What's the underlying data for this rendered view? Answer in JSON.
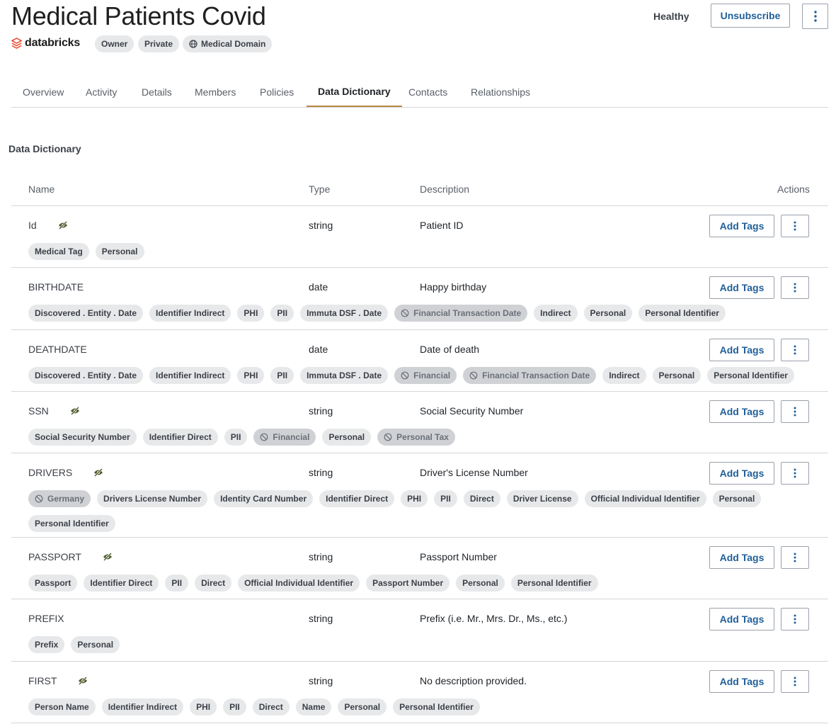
{
  "header": {
    "title": "Medical Patients Covid",
    "health_status": "Healthy",
    "unsubscribe_label": "Unsubscribe",
    "logo_text": "databricks",
    "chips": [
      {
        "label": "Owner",
        "icon": null
      },
      {
        "label": "Private",
        "icon": null
      },
      {
        "label": "Medical Domain",
        "icon": "globe-icon"
      }
    ]
  },
  "tabs": [
    {
      "label": "Overview",
      "active": false
    },
    {
      "label": "Activity",
      "active": false
    },
    {
      "label": "Details",
      "active": false
    },
    {
      "label": "Members",
      "active": false
    },
    {
      "label": "Policies",
      "active": false
    },
    {
      "label": "Data Dictionary",
      "active": true
    },
    {
      "label": "Contacts",
      "active": false
    },
    {
      "label": "Relationships",
      "active": false
    }
  ],
  "section": {
    "title": "Data Dictionary"
  },
  "table": {
    "columns": [
      "Name",
      "Type",
      "Description",
      "Actions"
    ],
    "add_tags_label": "Add Tags",
    "rows": [
      {
        "name": "Id",
        "masked": true,
        "type": "string",
        "description": "Patient ID",
        "tags": [
          {
            "label": "Medical Tag"
          },
          {
            "label": "Personal"
          }
        ]
      },
      {
        "name": "BIRTHDATE",
        "masked": false,
        "type": "date",
        "description": "Happy birthday",
        "tags": [
          {
            "label": "Discovered . Entity . Date"
          },
          {
            "label": "Identifier Indirect"
          },
          {
            "label": "PHI"
          },
          {
            "label": "PII"
          },
          {
            "label": "Immuta DSF . Date"
          },
          {
            "label": "Financial Transaction Date",
            "disabled": true
          },
          {
            "label": "Indirect"
          },
          {
            "label": "Personal"
          },
          {
            "label": "Personal Identifier"
          }
        ]
      },
      {
        "name": "DEATHDATE",
        "masked": false,
        "type": "date",
        "description": "Date of death",
        "tags": [
          {
            "label": "Discovered . Entity . Date"
          },
          {
            "label": "Identifier Indirect"
          },
          {
            "label": "PHI"
          },
          {
            "label": "PII"
          },
          {
            "label": "Immuta DSF . Date"
          },
          {
            "label": "Financial",
            "disabled": true
          },
          {
            "label": "Financial Transaction Date",
            "disabled": true
          },
          {
            "label": "Indirect"
          },
          {
            "label": "Personal"
          },
          {
            "label": "Personal Identifier"
          }
        ]
      },
      {
        "name": "SSN",
        "masked": true,
        "type": "string",
        "description": "Social Security Number",
        "tags": [
          {
            "label": "Social Security Number"
          },
          {
            "label": "Identifier Direct"
          },
          {
            "label": "PII"
          },
          {
            "label": "Financial",
            "disabled": true
          },
          {
            "label": "Personal"
          },
          {
            "label": "Personal Tax",
            "disabled": true
          }
        ]
      },
      {
        "name": "DRIVERS",
        "masked": true,
        "type": "string",
        "description": "Driver's License Number",
        "tags": [
          {
            "label": "Germany",
            "disabled": true
          },
          {
            "label": "Drivers License Number"
          },
          {
            "label": "Identity Card Number"
          },
          {
            "label": "Identifier Direct"
          },
          {
            "label": "PHI"
          },
          {
            "label": "PII"
          },
          {
            "label": "Direct"
          },
          {
            "label": "Driver License"
          },
          {
            "label": "Official Individual Identifier"
          },
          {
            "label": "Personal"
          },
          {
            "label": "Personal Identifier"
          }
        ]
      },
      {
        "name": "PASSPORT",
        "masked": true,
        "type": "string",
        "description": "Passport Number",
        "tags": [
          {
            "label": "Passport"
          },
          {
            "label": "Identifier Direct"
          },
          {
            "label": "PII"
          },
          {
            "label": "Direct"
          },
          {
            "label": "Official Individual Identifier"
          },
          {
            "label": "Passport Number"
          },
          {
            "label": "Personal"
          },
          {
            "label": "Personal Identifier"
          }
        ]
      },
      {
        "name": "PREFIX",
        "masked": false,
        "type": "string",
        "description": "Prefix (i.e. Mr., Mrs. Dr., Ms., etc.)",
        "tags": [
          {
            "label": "Prefix"
          },
          {
            "label": "Personal"
          }
        ]
      },
      {
        "name": "FIRST",
        "masked": true,
        "type": "string",
        "description": "No description provided.",
        "tags": [
          {
            "label": "Person Name"
          },
          {
            "label": "Identifier Indirect"
          },
          {
            "label": "PHI"
          },
          {
            "label": "PII"
          },
          {
            "label": "Direct"
          },
          {
            "label": "Name"
          },
          {
            "label": "Personal"
          },
          {
            "label": "Personal Identifier"
          }
        ]
      }
    ]
  }
}
